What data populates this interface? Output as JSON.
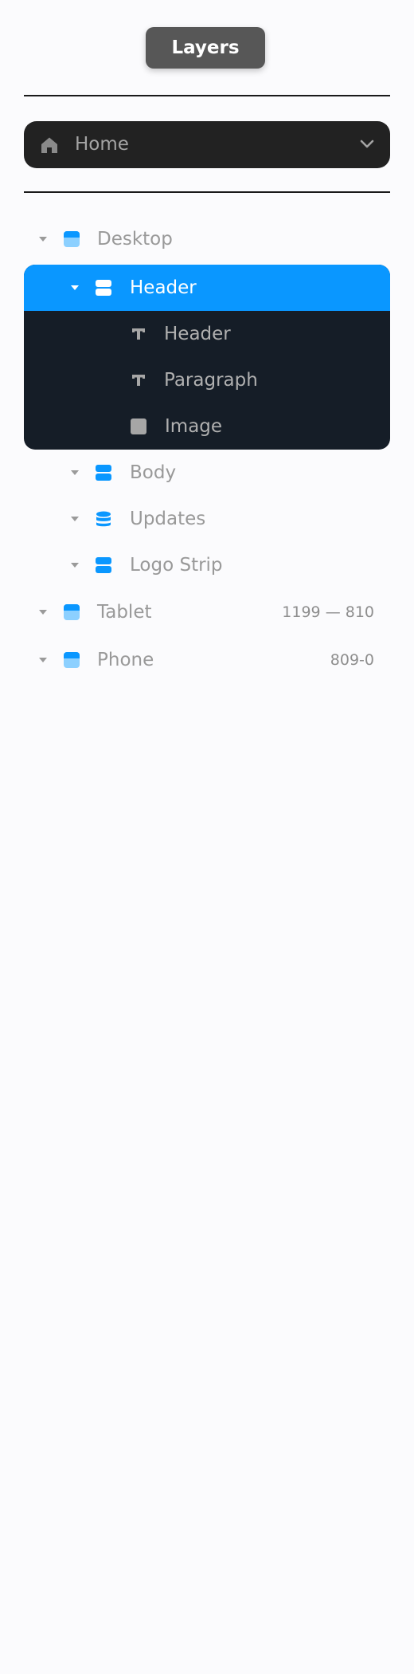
{
  "panel": {
    "title": "Layers"
  },
  "page_selector": {
    "icon": "home-icon",
    "label": "Home",
    "chevron": "chevron-down-icon"
  },
  "layers": {
    "desktop": {
      "label": "Desktop",
      "icon": "breakpoint-frame-icon",
      "expanded": true
    },
    "header": {
      "label": "Header",
      "icon": "stack-frame-icon",
      "expanded": true,
      "selected": true
    },
    "header_text": {
      "label": "Header",
      "icon": "text-icon"
    },
    "paragraph": {
      "label": "Paragraph",
      "icon": "text-icon"
    },
    "image": {
      "label": "Image",
      "icon": "image-icon"
    },
    "body": {
      "label": "Body",
      "icon": "stack-frame-icon",
      "expanded": true
    },
    "updates": {
      "label": "Updates",
      "icon": "cms-collection-icon",
      "expanded": true
    },
    "logo_strip": {
      "label": "Logo Strip",
      "icon": "stack-frame-icon",
      "expanded": true
    },
    "tablet": {
      "label": "Tablet",
      "icon": "breakpoint-frame-icon",
      "expanded": true,
      "range": "1199 — 810"
    },
    "phone": {
      "label": "Phone",
      "icon": "breakpoint-frame-icon",
      "expanded": true,
      "range": "809-0"
    }
  },
  "colors": {
    "selection": "#0a97ff",
    "group_background": "#151d27",
    "frame_icon": "#0a97ff",
    "breakpoint_icon": "#0a97ff",
    "title_pill": "#575757",
    "page_selector": "#222222"
  }
}
